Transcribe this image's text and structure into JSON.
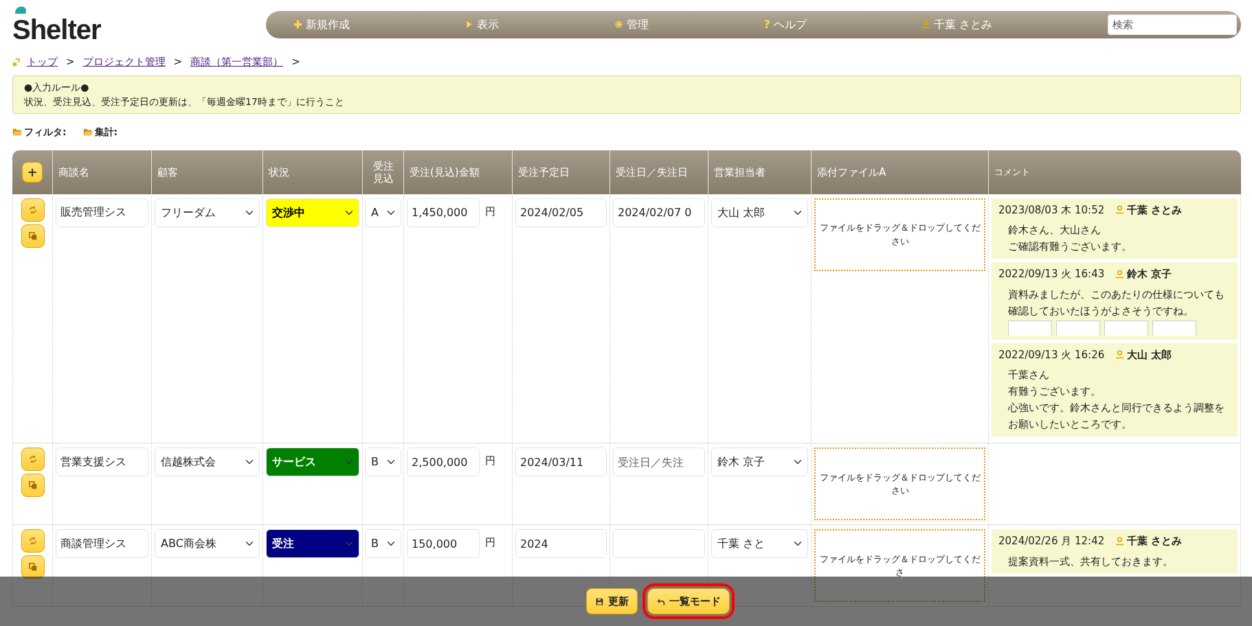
{
  "logo": {
    "text": "Shelter"
  },
  "nav": {
    "items": [
      {
        "kind": "create",
        "label": "新規作成"
      },
      {
        "kind": "view",
        "label": "表示"
      },
      {
        "kind": "admin",
        "label": "管理"
      },
      {
        "kind": "glyph",
        "glyph": "?",
        "label": "ヘルプ"
      },
      {
        "kind": "user",
        "label": "千葉 さとみ"
      }
    ],
    "search": {
      "placeholder": "検索"
    }
  },
  "breadcrumb": [
    {
      "label": "トップ",
      "separator": ">"
    },
    {
      "label": "プロジェクト管理",
      "separator": ">"
    },
    {
      "label": "商談（第一営業部）",
      "separator": ">"
    }
  ],
  "notice": {
    "title": "●入力ルール●",
    "body": "状況、受注見込、受注予定日の更新は、「毎週金曜17時まで」に行うこと"
  },
  "toggles": [
    {
      "label": "フィルタ:"
    },
    {
      "label": "集計:"
    }
  ],
  "table": {
    "add_button": "+",
    "columns": [
      {
        "lines": [
          "商談名"
        ]
      },
      {
        "lines": [
          "顧客"
        ]
      },
      {
        "lines": [
          "状況"
        ]
      },
      {
        "lines": [
          "受注",
          "見込"
        ]
      },
      {
        "lines": [
          "受注(見込)金額"
        ]
      },
      {
        "lines": [
          "受注予定日"
        ]
      },
      {
        "lines": [
          "受注日／失注日"
        ]
      },
      {
        "lines": [
          "営業担当者"
        ]
      },
      {
        "lines": [
          "添付ファイルA"
        ]
      },
      {
        "lines": [
          "コメント"
        ]
      }
    ],
    "rows": [
      {
        "name": "販売管理シス",
        "customer": "フリーダム",
        "status": {
          "label": "交渉中",
          "color": "#ffff00"
        },
        "prospect": "A",
        "amount": "1,450,000",
        "currency": "円",
        "planned_date": "2024/02/05",
        "closed_date": {
          "value": "2024/02/07 0"
        },
        "rep": "大山 太郎",
        "attachment_hint": "ファイルをドラッグ＆ドロップしてください",
        "comments": [
          {
            "datetime": "2023/08/03 木 10:52",
            "author": "千葉 さとみ",
            "body": [
              "鈴木さん、大山さん",
              "ご確認有難うございます。"
            ],
            "thumbnails": false
          },
          {
            "datetime": "2022/09/13 火 16:43",
            "author": "鈴木 京子",
            "body": [
              "資料みましたが、このあたりの仕様についても確認しておいたほうがよさそうですね。"
            ],
            "thumbnails": true
          },
          {
            "datetime": "2022/09/13 火 16:26",
            "author": "大山 太郎",
            "body": [
              "千葉さん",
              "有難うございます。",
              "心強いです。鈴木さんと同行できるよう調整をお願いしたいところです。"
            ],
            "thumbnails": false
          }
        ]
      },
      {
        "name": "営業支援シス",
        "customer": "信越株式会",
        "status": {
          "label": "サービス",
          "color": "#008000"
        },
        "prospect": "B",
        "amount": "2,500,000",
        "currency": "円",
        "planned_date": "2024/03/11",
        "closed_date": {
          "placeholder": "受注日／失注"
        },
        "rep": "鈴木 京子",
        "attachment_hint": "ファイルをドラッグ＆ドロップしてください",
        "comments": []
      },
      {
        "name": "商談管理シス",
        "customer": "ABC商会株",
        "status": {
          "label": "受注",
          "color": "#000080"
        },
        "prospect": "B",
        "amount": "150,000",
        "currency": "円",
        "planned_date": "2024",
        "closed_date": {},
        "rep": "千葉 さと",
        "attachment_hint": "ファイルをドラッグ＆ドロップしてくださ",
        "comments": [
          {
            "datetime": "2024/02/26 月 12:42",
            "author": "千葉 さとみ",
            "body": [
              "提案資料一式、共有しておきます。"
            ],
            "thumbnails": false
          }
        ]
      }
    ]
  },
  "action_bar": {
    "buttons": [
      {
        "kind": "save",
        "label": "更新",
        "highlighted": false
      },
      {
        "kind": "back",
        "label": "一覧モード",
        "highlighted": true
      }
    ]
  }
}
